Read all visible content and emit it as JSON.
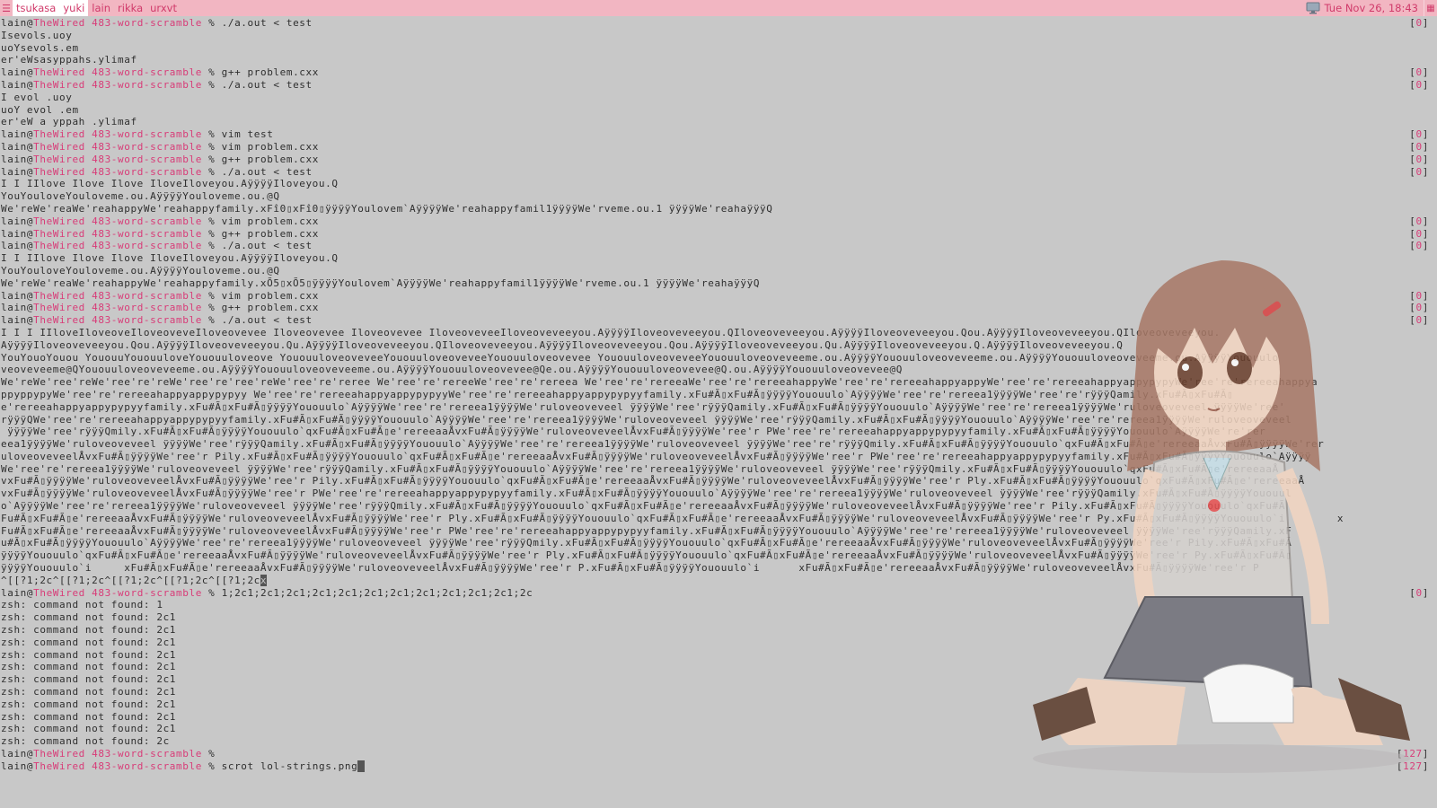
{
  "topbar": {
    "menu_icon": "menu-icon",
    "tags": [
      {
        "label": "tsukasa",
        "state": "focused"
      },
      {
        "label": "yuki",
        "state": "urgent"
      },
      {
        "label": "lain",
        "state": "normal"
      },
      {
        "label": "rikka",
        "state": "normal"
      },
      {
        "label": "urxvt",
        "state": "normal"
      }
    ],
    "clock_icon": "monitor-icon",
    "clock": "Tue Nov 26, 18:43",
    "layout_icon": "tile-layout-icon"
  },
  "prompt": {
    "user": "lain",
    "at": "@",
    "host": "TheWired",
    "dir": "483-word-scramble",
    "symbol": "%"
  },
  "terminal": {
    "lines": [
      {
        "type": "cmd",
        "cmd": "./a.out < test",
        "status": "0"
      },
      {
        "type": "out",
        "text": "Isevols.uoy"
      },
      {
        "type": "out",
        "text": "uoYsevols.em"
      },
      {
        "type": "out",
        "text": "er'eWsasyppahs.ylimaf"
      },
      {
        "type": "cmd",
        "cmd": "g++ problem.cxx",
        "status": "0"
      },
      {
        "type": "cmd",
        "cmd": "./a.out < test",
        "status": "0"
      },
      {
        "type": "out",
        "text": "I evol .uoy"
      },
      {
        "type": "out",
        "text": "uoY evol .em"
      },
      {
        "type": "out",
        "text": "er'eW a yppah .ylimaf"
      },
      {
        "type": "cmd",
        "cmd": "vim test",
        "status": "0"
      },
      {
        "type": "cmd",
        "cmd": "vim problem.cxx",
        "status": "0"
      },
      {
        "type": "cmd",
        "cmd": "g++ problem.cxx",
        "status": "0"
      },
      {
        "type": "cmd",
        "cmd": "./a.out < test",
        "status": "0"
      },
      {
        "type": "out",
        "text": "I I IIlove Ilove Ilove IloveIloveyou.AÿÿÿÿIloveyou.Q"
      },
      {
        "type": "out",
        "text": "YouYouloveYouloveme.ou.AÿÿÿÿYouloveme.ou.@Q"
      },
      {
        "type": "out",
        "text": "We'reWe'reaWe'reahappyWe'reahappyfamily.xFî0▯xFî0▯ÿÿÿÿYoulovem`AÿÿÿÿWe'reahappyfamil1ÿÿÿÿWe'rveme.ou.1 ÿÿÿÿWe'reahaÿÿÿQ"
      },
      {
        "type": "cmd",
        "cmd": "vim problem.cxx",
        "status": "0"
      },
      {
        "type": "cmd",
        "cmd": "g++ problem.cxx",
        "status": "0"
      },
      {
        "type": "cmd",
        "cmd": "./a.out < test",
        "status": "0"
      },
      {
        "type": "out",
        "text": "I I IIlove Ilove Ilove IloveIloveyou.AÿÿÿÿIloveyou.Q"
      },
      {
        "type": "out",
        "text": "YouYouloveYouloveme.ou.AÿÿÿÿYouloveme.ou.@Q"
      },
      {
        "type": "out",
        "text": "We'reWe'reaWe'reahappyWe'reahappyfamily.xÕ5▯xÕ5▯ÿÿÿÿYoulovem`AÿÿÿÿWe'reahappyfamil1ÿÿÿÿWe'rveme.ou.1 ÿÿÿÿWe'reahaÿÿÿQ"
      },
      {
        "type": "cmd",
        "cmd": "vim problem.cxx",
        "status": "0"
      },
      {
        "type": "cmd",
        "cmd": "g++ problem.cxx",
        "status": "0"
      },
      {
        "type": "cmd",
        "cmd": "./a.out < test",
        "status": "0"
      },
      {
        "type": "out",
        "text": "I I I IIloveIloveoveIloveoveveIloveovevee Iloveovevee Iloveovevee IloveoveveeIloveoveveeyou.AÿÿÿÿIloveoveveeyou.QIloveoveveeyou.AÿÿÿÿIloveoveveeyou.Qou.AÿÿÿÿIloveoveveeyou.QIloveoveveeyou."
      },
      {
        "type": "out",
        "text": "AÿÿÿÿIloveoveveeyou.Qou.AÿÿÿÿIloveoveveeyou.Qu.AÿÿÿÿIloveoveveeyou.QIloveoveveeyou.AÿÿÿÿIloveoveveeyou.Qou.AÿÿÿÿIloveoveveeyou.Qu.AÿÿÿÿIloveoveveeyou.Q.AÿÿÿÿIloveoveveeyou.Q"
      },
      {
        "type": "out",
        "text": "YouYouoYouou YououuYououuloveYououuloveove YououuloveoveveeYououuloveoveveeYououuloveovevee YououuloveoveveeYououuloveoveveeme.ou.AÿÿÿÿYououuloveoveveeme.ou.AÿÿÿÿYououuloveoveveeme.ou.AÿÿÿÿYououulo"
      },
      {
        "type": "out",
        "text": "veoveveeme@QYououuloveoveveeme.ou.AÿÿÿÿYououuloveoveveeme.ou.AÿÿÿÿYououuloveovevee@Qe.ou.AÿÿÿÿYououuloveovevee@Q.ou.AÿÿÿÿYououuloveovevee@Q"
      },
      {
        "type": "out",
        "text": "We'reWe'ree'reWe'ree're'reWe'ree're'ree'reWe'ree're'reree We'ree're'rereeWe'ree're'rereea We'ree're'rereeaWe'ree're'rereeahappyWe'ree're'rereeahappyappyWe'ree're'rereeahappyappypypyWe'ree're'rereeahappya"
      },
      {
        "type": "out",
        "text": "ppyppypyWe'ree're'rereeahappyappypypyy We'ree're'rereeahappyappypypyyWe'ree're'rereeahappyappypypyyfamily.xFu#Ã▯xFu#Ã▯ÿÿÿÿYououulo`AÿÿÿÿWe'ree're'rereea1ÿÿÿÿWe'ree're'rÿÿÿQamily.xFu#Ã▯xFu#Ã▯"
      },
      {
        "type": "out",
        "text": "e'rereeahappyappypypyyfamily.xFu#Ã▯xFu#Ã▯ÿÿÿÿYououulo`AÿÿÿÿWe'ree're'rereea1ÿÿÿÿWe'ruloveoveveel ÿÿÿÿWe'ree'rÿÿÿQamily.xFu#Ã▯xFu#Ã▯ÿÿÿÿYououulo`AÿÿÿÿWe'ree're'rereea1ÿÿÿÿWe'ruloveoveveel ÿÿÿÿWe'ree'"
      },
      {
        "type": "out",
        "text": "rÿÿÿQWe'ree're'rereeahappyappypypyyfamily.xFu#Ã▯xFu#Ã▯ÿÿÿÿYououulo`AÿÿÿÿWe'ree're'rereea1ÿÿÿÿWe'ruloveoveveel ÿÿÿÿWe'ree'rÿÿÿQamily.xFu#Ã▯xFu#Ã▯ÿÿÿÿYououulo`AÿÿÿÿWe'ree're'rereea1ÿÿÿÿWe'ruloveoveveel"
      },
      {
        "type": "out",
        "text": " ÿÿÿÿWe'ree'rÿÿÿQmily.xFu#Ã▯xFu#Ã▯ÿÿÿÿYououulo`qxFu#Ã▯xFu#Ã▯e'rereeaaÅvxFu#Ã▯ÿÿÿÿWe'ruloveoveveelÅvxFu#Ã▯ÿÿÿÿWe'ree'r PWe'ree're'rereeahappyappypypyyfamily.xFu#Ã▯xFu#Ã▯ÿÿÿÿYououulo`AÿÿÿÿWe're'rer"
      },
      {
        "type": "out",
        "text": "eea1ÿÿÿÿWe'ruloveoveveel ÿÿÿÿWe'ree'rÿÿÿQamily.xFu#Ã▯xFu#Ã▯ÿÿÿÿYououulo`AÿÿÿÿWe'ree're'rereea1ÿÿÿÿWe'ruloveoveveel ÿÿÿÿWe'ree're'rÿÿÿQmily.xFu#Ã▯xFu#Ã▯ÿÿÿÿYououulo`qxFu#Ã▯xFu#Ã▯e'rereeaaÅvxFu#Ã▯ÿÿÿÿWe'rer"
      },
      {
        "type": "out",
        "text": "uloveoveveelÅvxFu#Ã▯ÿÿÿÿWe'ree'r Pily.xFu#Ã▯xFu#Ã▯ÿÿÿÿYououulo`qxFu#Ã▯xFu#Ã▯e'rereeaaÅvxFu#Ã▯ÿÿÿÿWe'ruloveoveveelÅvxFu#Ã▯ÿÿÿÿWe'ree'r PWe'ree're'rereeahappyappypypyyfamily.xFu#Ã▯xFu#Ã▯ÿÿÿÿYououulo`Aÿÿÿÿ"
      },
      {
        "type": "out",
        "text": "We'ree're'rereea1ÿÿÿÿWe'ruloveoveveel ÿÿÿÿWe'ree'rÿÿÿQamily.xFu#Ã▯xFu#Ã▯ÿÿÿÿYououulo`AÿÿÿÿWe'ree're'rereea1ÿÿÿÿWe'ruloveoveveel ÿÿÿÿWe'ree'rÿÿÿQmily.xFu#Ã▯xFu#Ã▯ÿÿÿÿYououulo`qxFu#Ã▯xFu#Ã▯e'rereeaaÅ"
      },
      {
        "type": "out",
        "text": "vxFu#Ã▯ÿÿÿÿWe'ruloveoveveelÅvxFu#Ã▯ÿÿÿÿWe'ree'r Pily.xFu#Ã▯xFu#Ã▯ÿÿÿÿYououulo`qxFu#Ã▯xFu#Ã▯e'rereeaaÅvxFu#Ã▯ÿÿÿÿWe'ruloveoveveelÅvxFu#Ã▯ÿÿÿÿWe'ree'r Ply.xFu#Ã▯xFu#Ã▯ÿÿÿÿYououulo`qxFu#Ã▯xFu#Ã▯e'rereeaaÅ"
      },
      {
        "type": "out",
        "text": "vxFu#Ã▯ÿÿÿÿWe'ruloveoveveelÅvxFu#Ã▯ÿÿÿÿWe'ree'r PWe'ree're'rereeahappyappypypyyfamily.xFu#Ã▯xFu#Ã▯ÿÿÿÿYououulo`AÿÿÿÿWe'ree're'rereea1ÿÿÿÿWe'ruloveoveveel ÿÿÿÿWe'ree'rÿÿÿQamily.xFu#Ã▯xFu#Ã▯ÿÿÿÿYououul"
      },
      {
        "type": "out",
        "text": "o`AÿÿÿÿWe'ree're'rereea1ÿÿÿÿWe'ruloveoveveel ÿÿÿÿWe'ree'rÿÿÿQmily.xFu#Ã▯xFu#Ã▯ÿÿÿÿYououulo`qxFu#Ã▯xFu#Ã▯e'rereeaaÅvxFu#Ã▯ÿÿÿÿWe'ruloveoveveelÅvxFu#Ã▯ÿÿÿÿWe'ree'r Pily.xFu#Ã▯xFu#Ã▯ÿÿÿÿYououulo`qxFu#Ã"
      },
      {
        "type": "out",
        "text": "Fu#Ã▯xFu#Ã▯e'rereeaaÅvxFu#Ã▯ÿÿÿÿWe'ruloveoveveelÅvxFu#Ã▯ÿÿÿÿWe'ree'r Ply.xFu#Ã▯xFu#Ã▯ÿÿÿÿYououulo`qxFu#Ã▯xFu#Ã▯e'rereeaaÅvxFu#Ã▯ÿÿÿÿWe'ruloveoveveelÅvxFu#Ã▯ÿÿÿÿWe'ree'r Py.xFu#Ã▯xFu#Ã▯ÿÿÿÿYououulo`i        x"
      },
      {
        "type": "out",
        "text": "Fu#Ã▯xFu#Ã▯e'rereeaaÅvxFu#Ã▯ÿÿÿÿWe'ruloveoveveelÅvxFu#Ã▯ÿÿÿÿWe'ree'r PWe'ree're'rereeahappyappypypyyfamily.xFu#Ã▯xFu#Ã▯ÿÿÿÿYououulo`AÿÿÿÿWe'ree're'rereea1ÿÿÿÿWe'ruloveoveveel ÿÿÿÿWe'ree'rÿÿÿQamily.xF"
      },
      {
        "type": "out",
        "text": "u#Ã▯xFu#Ã▯ÿÿÿÿYououulo`AÿÿÿÿWe'ree're'rereea1ÿÿÿÿWe'ruloveoveveel ÿÿÿÿWe'ree'rÿÿÿQmily.xFu#Ã▯xFu#Ã▯ÿÿÿÿYououulo`qxFu#Ã▯xFu#Ã▯e'rereeaaÅvxFu#Ã▯ÿÿÿÿWe'ruloveoveveelÅvxFu#Ã▯ÿÿÿÿWe'ree'r Pily.xFu#Ã▯xFu#Ã"
      },
      {
        "type": "out",
        "text": "ÿÿÿÿYououulo`qxFu#Ã▯xFu#Ã▯e'rereeaaÅvxFu#Ã▯ÿÿÿÿWe'ruloveoveveelÅvxFu#Ã▯ÿÿÿÿWe'ree'r Ply.xFu#Ã▯xFu#Ã▯ÿÿÿÿYououulo`qxFu#Ã▯xFu#Ã▯e'rereeaaÅvxFu#Ã▯ÿÿÿÿWe'ruloveoveveelÅvxFu#Ã▯ÿÿÿÿWe'ree'r Py.xFu#Ã▯xFu#Ã▯"
      },
      {
        "type": "out",
        "text": "ÿÿÿÿYououulo`i     xFu#Ã▯xFu#Ã▯e'rereeaaÅvxFu#Ã▯ÿÿÿÿWe'ruloveoveveelÅvxFu#Ã▯ÿÿÿÿWe'ree'r P.xFu#Ã▯xFu#Ã▯ÿÿÿÿYououulo`i      xFu#Ã▯xFu#Ã▯e'rereeaaÅvxFu#Ã▯ÿÿÿÿWe'ruloveoveveelÅvxFu#Ã▯ÿÿÿÿWe'ree'r P"
      },
      {
        "type": "out",
        "text": "^[[?1;2c^[[?1;2c^[[?1;2c^[[?1;2c^[[?1;2c",
        "cursor_end": "x"
      },
      {
        "type": "cmd",
        "cmd": "1;2c1;2c1;2c1;2c1;2c1;2c1;2c1;2c1;2c1;2c1;2c1;2c",
        "status": "0"
      },
      {
        "type": "out",
        "text": "zsh: command not found: 1"
      },
      {
        "type": "out",
        "text": "zsh: command not found: 2c1"
      },
      {
        "type": "out",
        "text": "zsh: command not found: 2c1"
      },
      {
        "type": "out",
        "text": "zsh: command not found: 2c1"
      },
      {
        "type": "out",
        "text": "zsh: command not found: 2c1"
      },
      {
        "type": "out",
        "text": "zsh: command not found: 2c1"
      },
      {
        "type": "out",
        "text": "zsh: command not found: 2c1"
      },
      {
        "type": "out",
        "text": "zsh: command not found: 2c1"
      },
      {
        "type": "out",
        "text": "zsh: command not found: 2c1"
      },
      {
        "type": "out",
        "text": "zsh: command not found: 2c1"
      },
      {
        "type": "out",
        "text": "zsh: command not found: 2c1"
      },
      {
        "type": "out",
        "text": "zsh: command not found: 2c"
      },
      {
        "type": "cmd",
        "cmd": "",
        "status": "127"
      },
      {
        "type": "cmd",
        "cmd": "scrot lol-strings.png",
        "status": "127",
        "cursor": true
      }
    ]
  }
}
